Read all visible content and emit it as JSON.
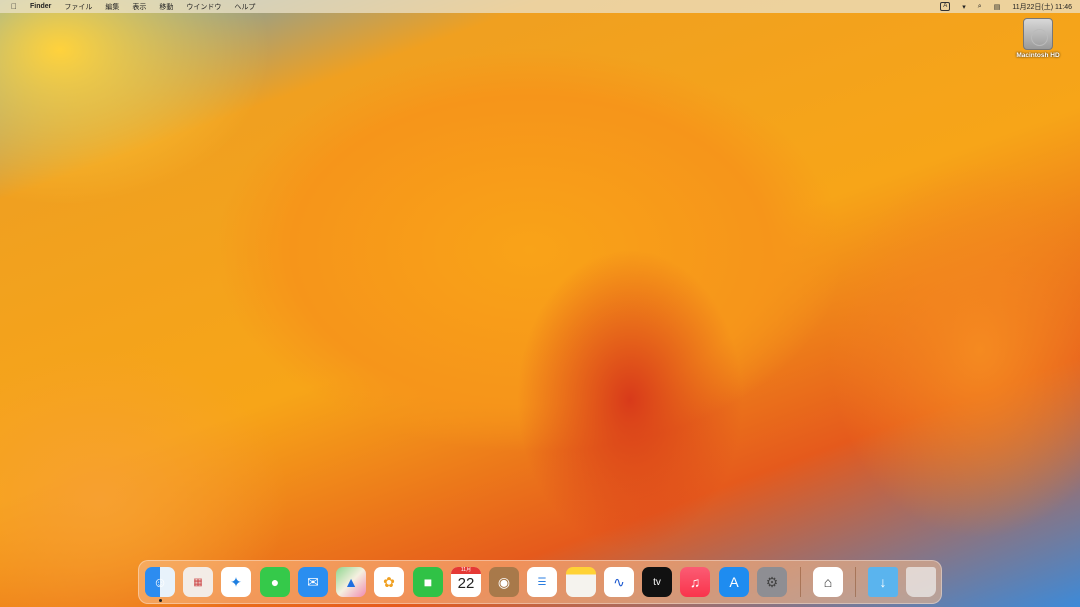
{
  "menubar": {
    "app_name": "Finder",
    "items": [
      "ファイル",
      "編集",
      "表示",
      "移動",
      "ウインドウ",
      "ヘルプ"
    ],
    "input_mode": "A",
    "datetime": "11月22日(土) 11:46"
  },
  "desktop": {
    "icons": [
      {
        "label": "Macintosh HD"
      }
    ]
  },
  "dock": {
    "calendar_month": "11月",
    "calendar_day": "22",
    "tv_label": "tv"
  }
}
